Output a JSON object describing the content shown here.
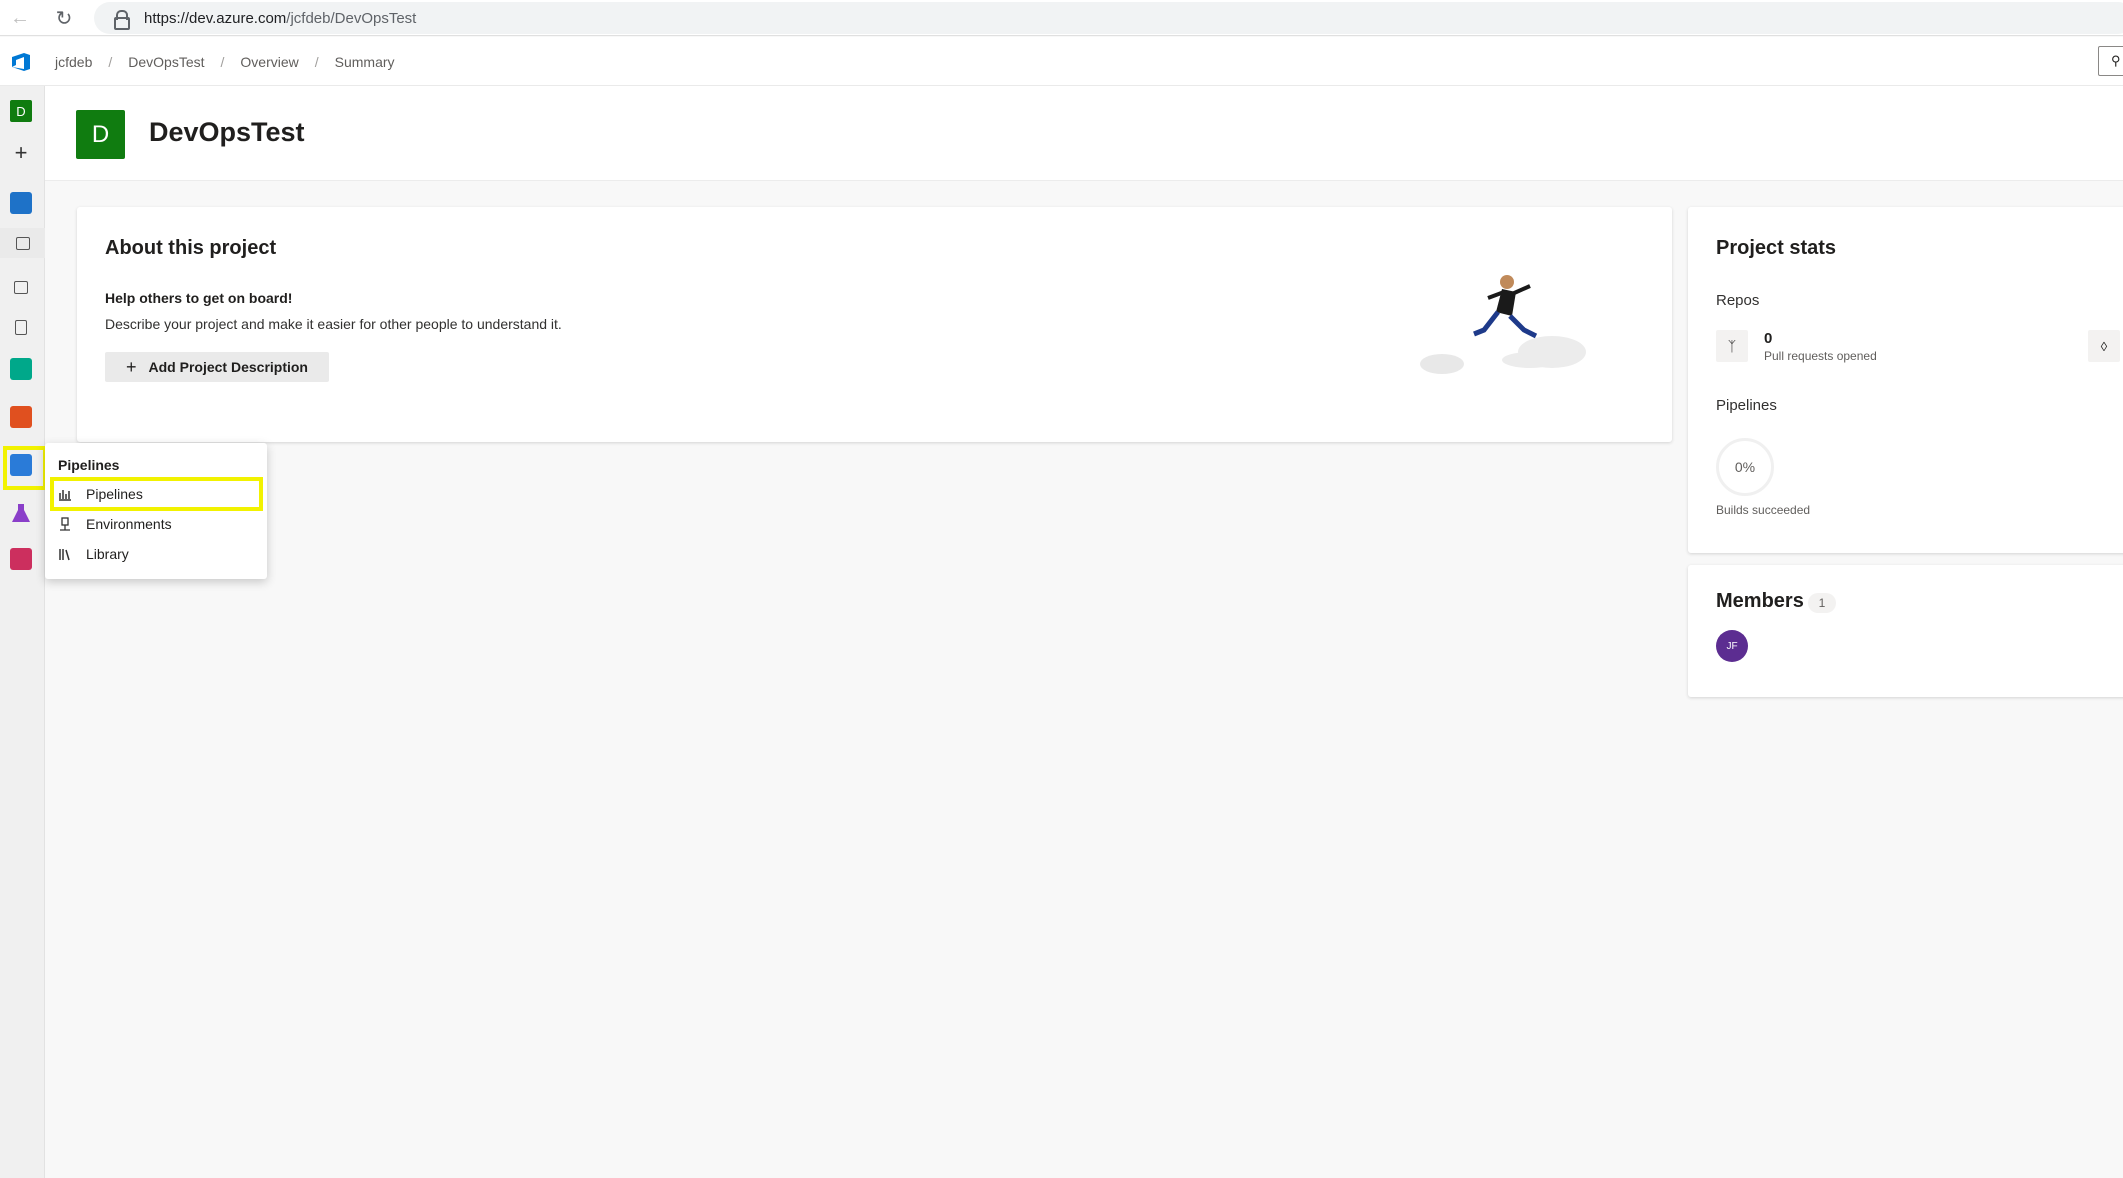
{
  "browser": {
    "url_host": "https://dev.azure.com",
    "url_path": "/jcfdeb/DevOpsTest"
  },
  "breadcrumb": {
    "org": "jcfdeb",
    "project": "DevOpsTest",
    "section": "Overview",
    "page": "Summary"
  },
  "rail": {
    "project_initial": "D"
  },
  "project": {
    "initial": "D",
    "name": "DevOpsTest"
  },
  "about": {
    "title": "About this project",
    "subtitle": "Help others to get on board!",
    "description": "Describe your project and make it easier for other people to understand it.",
    "add_button": "Add Project Description"
  },
  "stats": {
    "title": "Project stats",
    "repos_label": "Repos",
    "pull_requests_count": "0",
    "pull_requests_label": "Pull requests opened",
    "pipelines_label": "Pipelines",
    "builds_percent": "0%",
    "builds_label": "Builds succeeded"
  },
  "members": {
    "title": "Members",
    "count": "1",
    "avatar_initials": "JF"
  },
  "flyout": {
    "title": "Pipelines",
    "items": [
      {
        "label": "Pipelines",
        "icon": "pipelines-icon"
      },
      {
        "label": "Environments",
        "icon": "environments-icon"
      },
      {
        "label": "Library",
        "icon": "library-icon"
      }
    ]
  },
  "colors": {
    "project_green": "#107c10",
    "highlight_yellow": "#f2f200",
    "member_purple": "#5c2d91"
  }
}
